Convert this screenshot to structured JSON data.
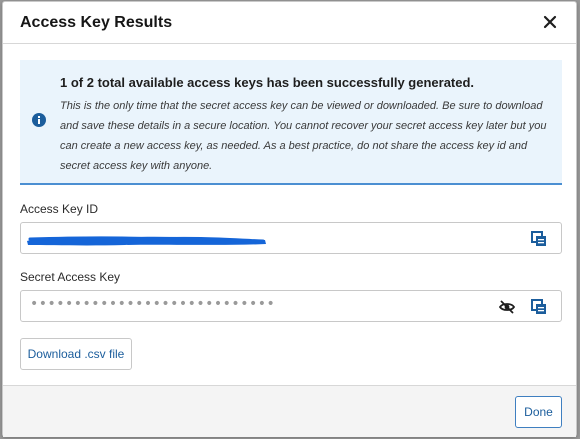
{
  "dialog": {
    "title": "Access Key Results",
    "close_icon": "close-icon"
  },
  "notice": {
    "icon": "info-icon",
    "title": "1 of 2 total available access keys has been successfully generated.",
    "body": "This is the only time that the secret access key can be viewed or downloaded. Be sure to download and save these details in a secure location. You cannot recover your secret access key later but you can create a new access key, as needed. As a best practice, do not share the access key id and secret access key with anyone."
  },
  "access_key_id": {
    "label": "Access Key ID",
    "copy_icon": "copy-icon"
  },
  "secret_access_key": {
    "label": "Secret Access Key",
    "masked_value": "••••••••••••••••••••••••••••",
    "visibility_icon": "eye-off-icon",
    "copy_icon": "copy-icon"
  },
  "download": {
    "label": "Download .csv file"
  },
  "footer": {
    "done_label": "Done"
  },
  "colors": {
    "accent": "#1b5d9c",
    "notice_bg": "#eaf4fc",
    "notice_border": "#4b8fd2",
    "redaction": "#1565d8"
  }
}
